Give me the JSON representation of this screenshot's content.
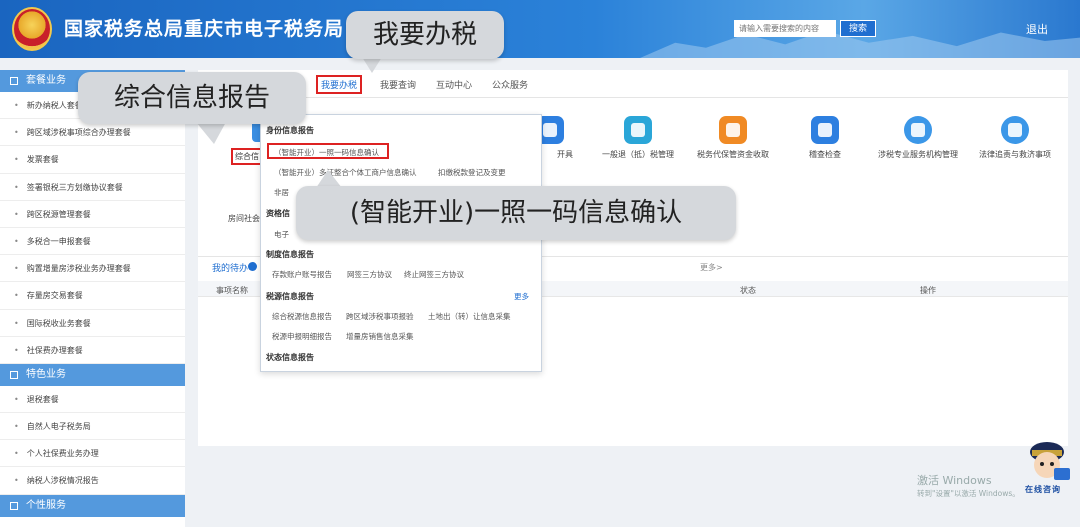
{
  "header": {
    "emblem_text": "",
    "title": "国家税务总局重庆市电子税务局",
    "search_placeholder": "请输入需要搜索的内容",
    "search_label": "搜索",
    "logout_label": "退出"
  },
  "sidebar": {
    "group1": "套餐业务",
    "group1_items": [
      "新办纳税人套餐",
      "跨区域涉税事项综合办理套餐",
      "发票套餐",
      "签署银税三方划缴协议套餐",
      "跨区税源管理套餐",
      "多税合一申报套餐",
      "购置增量房涉税业务办理套餐",
      "存量房交易套餐",
      "国际税收业务套餐",
      "社保费办理套餐"
    ],
    "group2": "特色业务",
    "group2_items": [
      "退税套餐",
      "自然人电子税务局",
      "个人社保费业务办理",
      "纳税人涉税情况报告"
    ],
    "group3": "个性服务"
  },
  "topnav": {
    "partial": "息",
    "active": "我要办税",
    "items": [
      "我要查询",
      "互动中心",
      "公众服务"
    ]
  },
  "services": [
    {
      "label": "开具",
      "color": "#2d7fe0"
    },
    {
      "label": "一般退（抵）税管理",
      "color": "#2aa6d8"
    },
    {
      "label": "税务代保管资金收取",
      "color": "#f08a24"
    },
    {
      "label": "稽查检查",
      "color": "#2d7fe0"
    },
    {
      "label": "涉税专业服务机构管理",
      "color": "#3b97e8"
    },
    {
      "label": "法律追责与救济事项",
      "color": "#3b97e8"
    }
  ],
  "left_labels": {
    "zonghe": "综合信",
    "fangwu": "房间社会办"
  },
  "pending": {
    "tab": "我的待办",
    "more": "更多>",
    "col_name": "事项名称",
    "col_status": "状态",
    "col_op": "操作"
  },
  "dropdown": {
    "sec1": "身份信息报告",
    "sec1_links": [
      "（智能开业）一照一码信息确认",
      "（智能开业）多证整合个体工商户信息确认",
      "扣缴税款登记及变更"
    ],
    "sec1_row3": "非居",
    "sec2": "资格信",
    "sec2_row": "电子",
    "sec3": "制度信息报告",
    "sec3_links": [
      "存款账户账号报告",
      "网签三方协议",
      "终止网签三方协议"
    ],
    "sec4": "税源信息报告",
    "sec4_more": "更多",
    "sec4_links": [
      "综合税源信息报告",
      "跨区域涉税事项报验",
      "土地出（转）让信息采集"
    ],
    "sec4_links2": [
      "税源申报明细报告",
      "增量房销售信息采集"
    ],
    "sec5": "状态信息报告"
  },
  "callouts": {
    "c1": "我要办税",
    "c2": "综合信息报告",
    "c3": "(智能开业)一照一码信息确认"
  },
  "watermark": {
    "line1": "激活 Windows",
    "line2": "转到\"设置\"以激活 Windows。"
  },
  "mascot_text": "在线咨询"
}
